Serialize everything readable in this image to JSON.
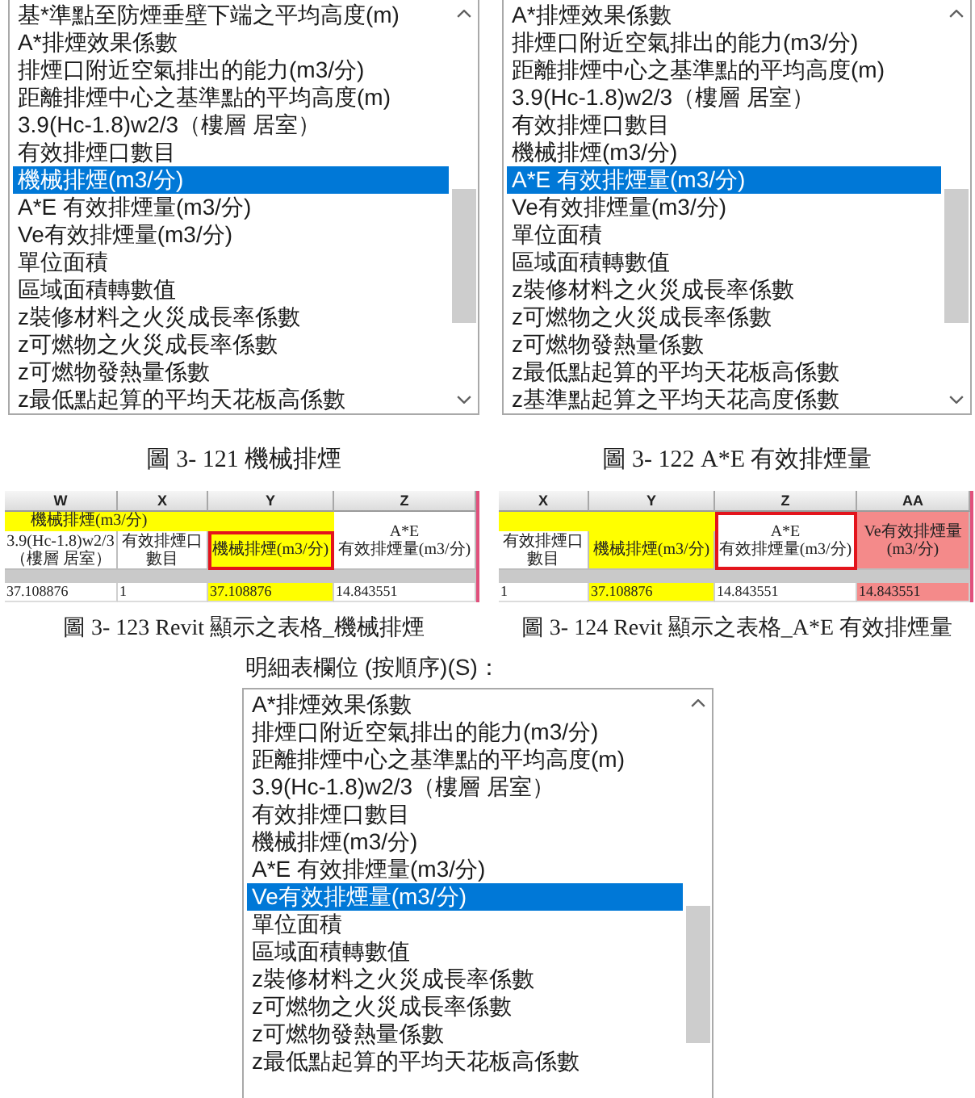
{
  "figures": [
    {
      "list": {
        "items": [
          {
            "text": "基*準點至防煙垂壁下端之平均高度(m)",
            "selected": false
          },
          {
            "text": "A*排煙效果係數",
            "selected": false
          },
          {
            "text": "排煙口附近空氣排出的能力(m3/分)",
            "selected": false
          },
          {
            "text": "距離排煙中心之基準點的平均高度(m)",
            "selected": false
          },
          {
            "text": "3.9(Hc-1.8)w2/3（樓層 居室）",
            "selected": false
          },
          {
            "text": "有效排煙口數目",
            "selected": false
          },
          {
            "text": "機械排煙(m3/分)",
            "selected": true
          },
          {
            "text": "A*E 有效排煙量(m3/分)",
            "selected": false
          },
          {
            "text": "Ve有效排煙量(m3/分)",
            "selected": false
          },
          {
            "text": "單位面積",
            "selected": false
          },
          {
            "text": "區域面積轉數值",
            "selected": false
          },
          {
            "text": "z裝修材料之火災成長率係數",
            "selected": false
          },
          {
            "text": "z可燃物之火災成長率係數",
            "selected": false
          },
          {
            "text": "z可燃物發熱量係數",
            "selected": false
          },
          {
            "text": "z最低點起算的平均天花板高係數",
            "selected": false
          }
        ]
      },
      "caption": "圖 3- 121 機械排煙"
    },
    {
      "list": {
        "items": [
          {
            "text": "A*排煙效果係數",
            "selected": false
          },
          {
            "text": "排煙口附近空氣排出的能力(m3/分)",
            "selected": false
          },
          {
            "text": "距離排煙中心之基準點的平均高度(m)",
            "selected": false
          },
          {
            "text": "3.9(Hc-1.8)w2/3（樓層 居室）",
            "selected": false
          },
          {
            "text": "有效排煙口數目",
            "selected": false
          },
          {
            "text": "機械排煙(m3/分)",
            "selected": false
          },
          {
            "text": "A*E 有效排煙量(m3/分)",
            "selected": true
          },
          {
            "text": "Ve有效排煙量(m3/分)",
            "selected": false
          },
          {
            "text": "單位面積",
            "selected": false
          },
          {
            "text": "區域面積轉數值",
            "selected": false
          },
          {
            "text": "z裝修材料之火災成長率係數",
            "selected": false
          },
          {
            "text": "z可燃物之火災成長率係數",
            "selected": false
          },
          {
            "text": "z可燃物發熱量係數",
            "selected": false
          },
          {
            "text": "z最低點起算的平均天花板高係數",
            "selected": false
          },
          {
            "text": "z基準點起算之平均天花高度係數",
            "selected": false
          }
        ]
      },
      "caption": "圖 3- 122 A*E 有效排煙量"
    }
  ],
  "tables": [
    {
      "table": {
        "columns": [
          "W",
          "X",
          "Y",
          "Z"
        ],
        "group_header": {
          "text": "機械排煙(m3/分)",
          "color": "#ffff00"
        },
        "headers": [
          {
            "kind": "field",
            "text": "3.9(Hc-1.8)w2/3（樓層 居室）",
            "highlighted": false
          },
          {
            "kind": "field",
            "text": "有效排煙口數目",
            "highlighted": false
          },
          {
            "kind": "field",
            "text": "機械排煙(m3/分)",
            "color": "#ffff00",
            "highlighted": true
          },
          {
            "kind": "merged",
            "text": "A*E\n有效排煙量(m3/分)",
            "highlighted": false
          }
        ],
        "rows": [
          [
            {
              "text": "37.108876"
            },
            {
              "text": "1"
            },
            {
              "text": "37.108876",
              "color": "#ffff00"
            },
            {
              "text": "14.843551"
            }
          ]
        ]
      },
      "caption": "圖 3- 123 Revit 顯示之表格_機械排煙"
    },
    {
      "table": {
        "columns": [
          "X",
          "Y",
          "Z",
          "AA"
        ],
        "group_header": {
          "color": "#ffff00"
        },
        "headers": [
          {
            "kind": "field",
            "text": "有效排煙口數目",
            "highlighted": false
          },
          {
            "kind": "field",
            "text": "機械排煙(m3/分)",
            "color": "#ffff00",
            "highlighted": false
          },
          {
            "kind": "merged",
            "text": "A*E\n有效排煙量(m3/分)",
            "highlighted": true
          },
          {
            "kind": "merged",
            "text": "Ve有效排煙量(m3/分)",
            "color": "#f48a8a",
            "highlighted": false
          }
        ],
        "rows": [
          [
            {
              "text": "1"
            },
            {
              "text": "37.108876",
              "color": "#ffff00"
            },
            {
              "text": "14.843551"
            },
            {
              "text": "14.843551",
              "color": "#f48a8a"
            }
          ]
        ]
      },
      "caption": "圖 3- 124 Revit 顯示之表格_A*E 有效排煙量"
    }
  ],
  "schedule_fields": {
    "label": "明細表欄位 (按順序)(S)：",
    "items": [
      {
        "text": "A*排煙效果係數",
        "selected": false
      },
      {
        "text": "排煙口附近空氣排出的能力(m3/分)",
        "selected": false
      },
      {
        "text": "距離排煙中心之基準點的平均高度(m)",
        "selected": false
      },
      {
        "text": "3.9(Hc-1.8)w2/3（樓層 居室）",
        "selected": false
      },
      {
        "text": "有效排煙口數目",
        "selected": false
      },
      {
        "text": "機械排煙(m3/分)",
        "selected": false
      },
      {
        "text": "A*E 有效排煙量(m3/分)",
        "selected": false
      },
      {
        "text": "Ve有效排煙量(m3/分)",
        "selected": true
      },
      {
        "text": "單位面積",
        "selected": false
      },
      {
        "text": "區域面積轉數值",
        "selected": false
      },
      {
        "text": "z裝修材料之火災成長率係數",
        "selected": false
      },
      {
        "text": "z可燃物之火災成長率係數",
        "selected": false
      },
      {
        "text": "z可燃物發熱量係數",
        "selected": false
      },
      {
        "text": "z最低點起算的平均天花板高係數",
        "selected": false
      }
    ]
  }
}
